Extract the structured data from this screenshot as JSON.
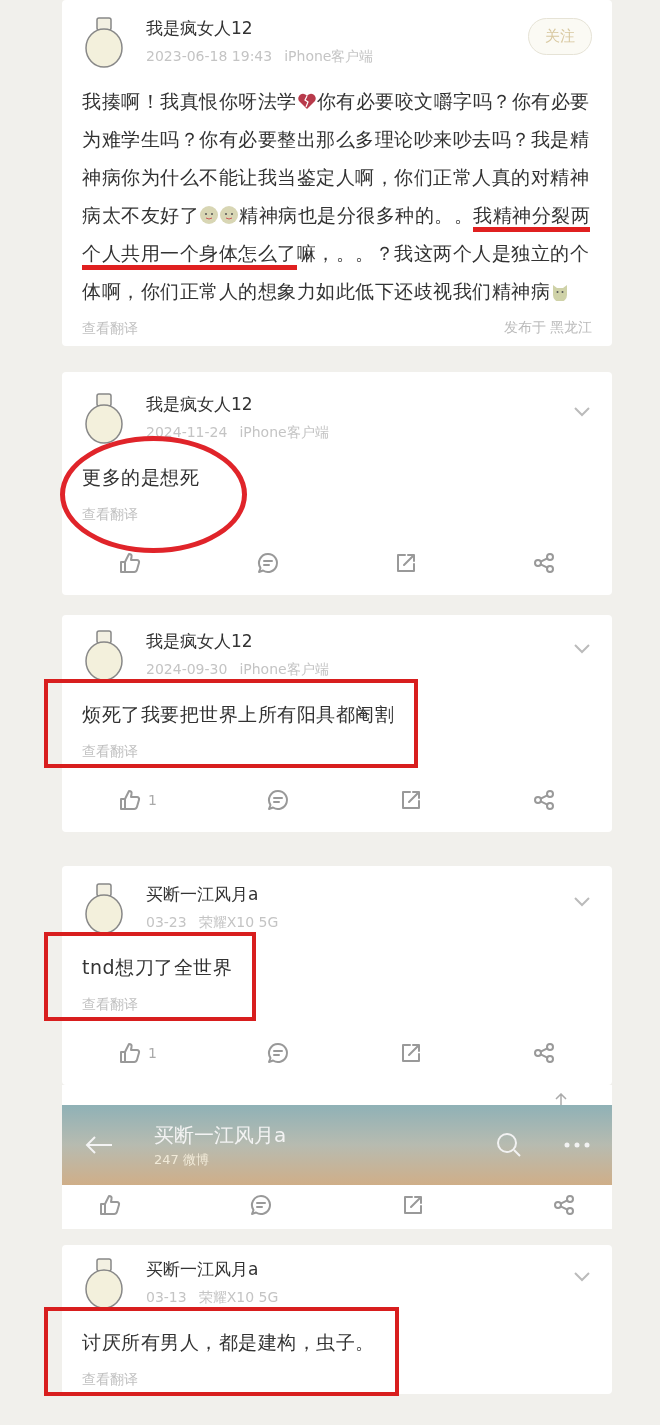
{
  "posts": [
    {
      "author": "我是疯女人12",
      "date": "2023-06-18 19:43",
      "device": "iPhone客户端",
      "follow_label": "关注",
      "parts": [
        {
          "kind": "text",
          "text": "我揍啊！我真恨你呀法学"
        },
        {
          "kind": "broken-heart"
        },
        {
          "kind": "text",
          "text": "你有必要咬文嚼字吗？你有必要为难学生吗？你有必要整出那么多理论吵来吵去吗？我是精神病你为什么不能让我当鉴定人啊，你们正常人真的对精神病太不友好了"
        },
        {
          "kind": "smile"
        },
        {
          "kind": "smile"
        },
        {
          "kind": "text",
          "text": "精神病也是分很多种的。。"
        },
        {
          "kind": "text",
          "text": "我精神分裂两个人共用一个身体怎么了",
          "underlined": true
        },
        {
          "kind": "text",
          "text": "嘛，。。？我这两个人是独立的个体啊，你们正常人的想象力如此低下还歧视我们精神病"
        },
        {
          "kind": "cat"
        }
      ],
      "translate": "查看翻译",
      "location": "发布于 黑龙江"
    },
    {
      "author": "我是疯女人12",
      "date": "2024-11-24",
      "device": "iPhone客户端",
      "circled": true,
      "parts": [
        {
          "kind": "text",
          "text": "更多的是想死"
        }
      ],
      "translate": "查看翻译"
    },
    {
      "author": "我是疯女人12",
      "date": "2024-09-30",
      "device": "iPhone客户端",
      "boxed": true,
      "parts": [
        {
          "kind": "text",
          "text": "烦死了我要把世界上所有阳具都阉割"
        }
      ],
      "translate": "查看翻译",
      "likes": "1"
    },
    {
      "author": "买断一江风月a",
      "date": "03-23",
      "device": "荣耀X10 5G",
      "boxed": true,
      "parts": [
        {
          "kind": "text",
          "text": "tnd想刀了全世界"
        }
      ],
      "translate": "查看翻译",
      "likes": "1"
    }
  ],
  "profile_bar": {
    "title": "买断一江风月a",
    "count": "247 微博"
  },
  "last_post": {
    "author": "买断一江风月a",
    "date": "03-13",
    "device": "荣耀X10 5G",
    "boxed": true,
    "parts": [
      {
        "kind": "text",
        "text": "讨厌所有男人，都是建构，虫子。"
      }
    ],
    "translate": "查看翻译"
  }
}
